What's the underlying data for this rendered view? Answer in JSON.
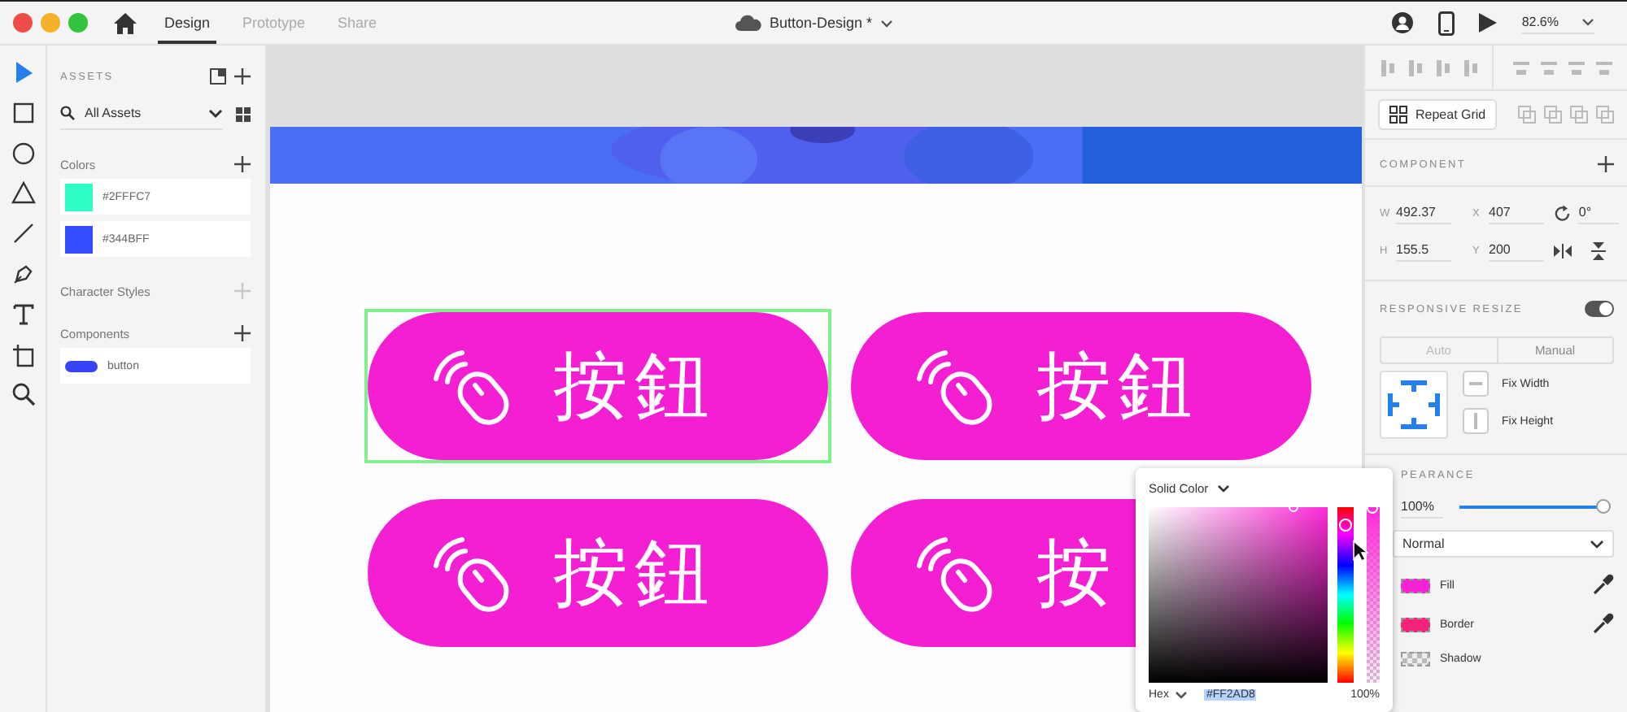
{
  "window": {
    "title": "Button-Design *"
  },
  "tabs": [
    {
      "label": "Design",
      "selected": true
    },
    {
      "label": "Prototype",
      "selected": false
    },
    {
      "label": "Share",
      "selected": false
    }
  ],
  "zoom": "82.6%",
  "tools": [
    {
      "kind": "select",
      "selected": true
    },
    {
      "kind": "rect",
      "selected": false
    },
    {
      "kind": "ellipse",
      "selected": false
    },
    {
      "kind": "polygon",
      "selected": false
    },
    {
      "kind": "line",
      "selected": false
    },
    {
      "kind": "pen",
      "selected": false
    },
    {
      "kind": "text",
      "selected": false
    },
    {
      "kind": "artboard",
      "selected": false
    },
    {
      "kind": "zoom",
      "selected": false
    }
  ],
  "assets": {
    "title": "ASSETS",
    "search": {
      "value": "All Assets"
    },
    "sections": [
      {
        "title": "Colors",
        "kind": "colors",
        "add_disabled": false,
        "items": [
          {
            "label": "#2FFFC7",
            "color": "#2fffc7"
          },
          {
            "label": "#344BFF",
            "color": "#344bff"
          }
        ]
      },
      {
        "title": "Character Styles",
        "add_disabled": true
      },
      {
        "title": "Components",
        "kind": "components",
        "add_disabled": false,
        "items": [
          {
            "label": "button"
          }
        ]
      }
    ]
  },
  "canvas": {
    "buttons": [
      {
        "label": "按鈕",
        "selected": true
      },
      {
        "label": "按鈕",
        "selected": false
      },
      {
        "label": "按鈕",
        "selected": false
      },
      {
        "label": "按",
        "selected": false
      }
    ]
  },
  "inspector": {
    "repeat_grid": "Repeat Grid",
    "component_title": "COMPONENT",
    "fields": [
      {
        "label": "W",
        "value": "492.37"
      },
      {
        "label": "X",
        "value": "407"
      },
      {
        "label": "H",
        "value": "155.5"
      },
      {
        "label": "Y",
        "value": "200"
      }
    ],
    "rotation": "0°",
    "responsive": {
      "title": "RESPONSIVE RESIZE",
      "on": true,
      "modes": [
        {
          "label": "Auto",
          "selected": false
        },
        {
          "label": "Manual",
          "selected": true
        }
      ],
      "fix": [
        "Fix Width",
        "Fix Height"
      ]
    },
    "appearance": {
      "title": "PEARANCE",
      "opacity": {
        "value": "100%",
        "level": 1
      },
      "blend": "Normal",
      "layers": [
        {
          "label": "Fill",
          "kind": "color",
          "color": "#f522d6",
          "eyedropper": true
        },
        {
          "label": "Border",
          "kind": "color",
          "color": "#f5227a",
          "eyedropper": true
        },
        {
          "label": "Shadow",
          "kind": "checker",
          "eyedropper": false
        }
      ]
    }
  },
  "color_picker": {
    "mode": "Solid Color",
    "hue": {
      "level": 0.9
    },
    "alpha_slider": {
      "level": 1
    },
    "format": "Hex",
    "value": "#FF2AD8",
    "alpha": "100%"
  }
}
